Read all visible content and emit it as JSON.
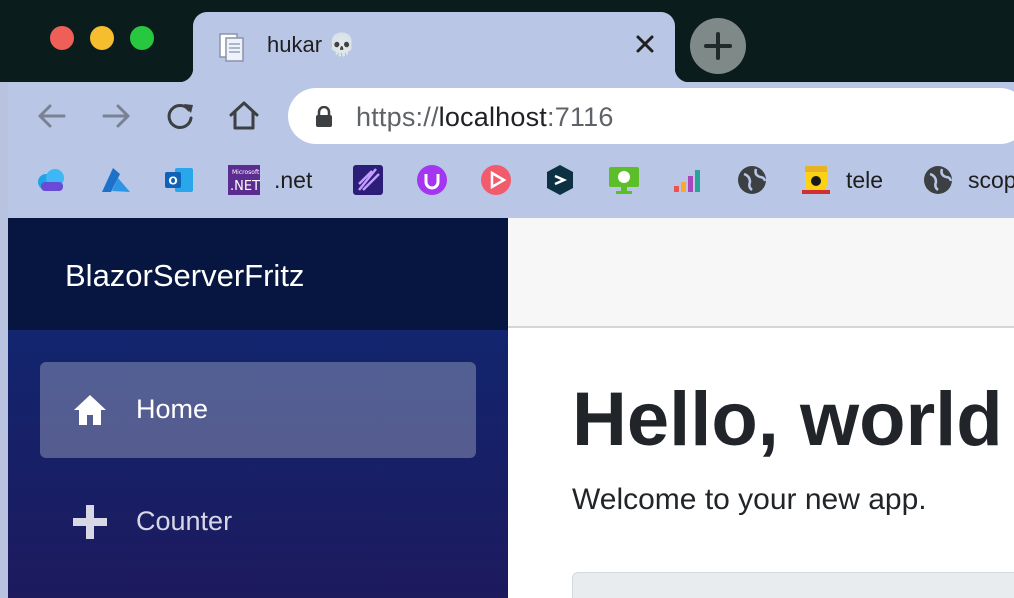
{
  "browser": {
    "tab": {
      "title": "hukar 💀"
    },
    "address": {
      "scheme": "https://",
      "host": "localhost",
      "port": ":7116"
    },
    "bookmarks": [
      {
        "label": "",
        "icon": "cloud-icon"
      },
      {
        "label": "",
        "icon": "azure-icon"
      },
      {
        "label": "",
        "icon": "outlook-icon"
      },
      {
        "label": ".net",
        "icon": "dotnet-icon"
      },
      {
        "label": "",
        "icon": "feather-icon"
      },
      {
        "label": "",
        "icon": "u-badge-icon"
      },
      {
        "label": "",
        "icon": "play-icon"
      },
      {
        "label": "",
        "icon": "hexagon-icon"
      },
      {
        "label": "",
        "icon": "monitor-icon"
      },
      {
        "label": "",
        "icon": "equalizer-icon"
      },
      {
        "label": "",
        "icon": "globe-icon"
      },
      {
        "label": "tele",
        "icon": "crest-icon"
      },
      {
        "label": "scop",
        "icon": "globe-icon"
      }
    ]
  },
  "app": {
    "brand": "BlazorServerFritz",
    "nav": [
      {
        "label": "Home",
        "icon": "home-icon",
        "active": true
      },
      {
        "label": "Counter",
        "icon": "plus-icon",
        "active": false
      }
    ],
    "heading": "Hello, world",
    "welcome": "Welcome to your new app."
  }
}
